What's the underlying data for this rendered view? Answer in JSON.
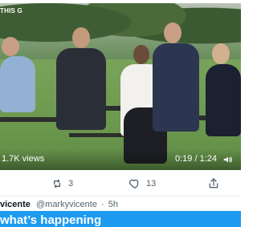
{
  "video": {
    "logo_text": "THIS\nG",
    "views": "1.7K views",
    "time": "0:19 / 1:24"
  },
  "actions": {
    "retweet_count": "3",
    "like_count": "13"
  },
  "tweet": {
    "name": "vicente",
    "handle": "@markyvicente",
    "separator": "·",
    "time_ago": "5h"
  },
  "compose": {
    "prompt": "what’s happening"
  },
  "colors": {
    "accent": "#1d9bf0",
    "muted_text": "#536471"
  }
}
